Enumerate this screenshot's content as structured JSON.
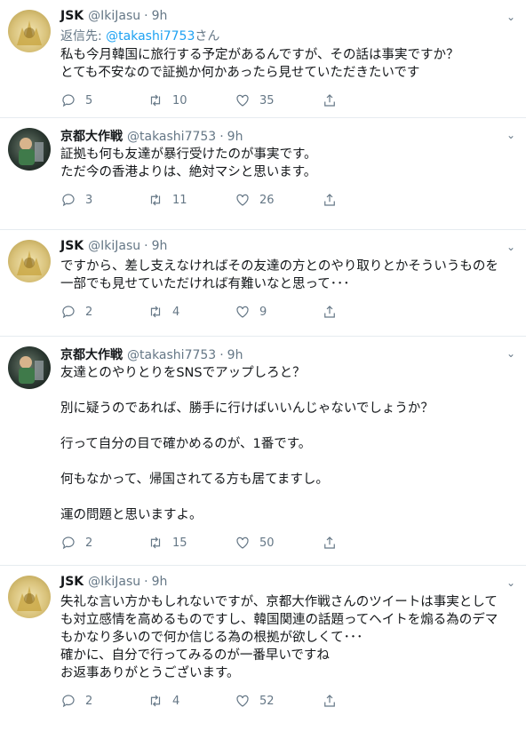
{
  "tweets": [
    {
      "user": "jsk",
      "name": "JSK",
      "handle": "@IkiJasu",
      "time": "9h",
      "reply_prefix": "返信先: ",
      "reply_mention": "@takashi7753",
      "reply_suffix": "さん",
      "text": "私も今月韓国に旅行する予定があるんですが、その話は事実ですか？\nとても不安なので証拠か何かあったら見せていただきたいです",
      "replies": "5",
      "retweets": "10",
      "likes": "35"
    },
    {
      "user": "kyoto",
      "name": "京都大作戦",
      "handle": "@takashi7753",
      "time": "9h",
      "text": "証拠も何も友達が暴行受けたのが事実です。\nただ今の香港よりは、絶対マシと思います。",
      "replies": "3",
      "retweets": "11",
      "likes": "26"
    },
    {
      "user": "jsk",
      "name": "JSK",
      "handle": "@IkiJasu",
      "time": "9h",
      "text": "ですから、差し支えなければその友達の方とのやり取りとかそういうものを\n一部でも見せていただければ有難いなと思って･･･",
      "replies": "2",
      "retweets": "4",
      "likes": "9"
    },
    {
      "user": "kyoto",
      "name": "京都大作戦",
      "handle": "@takashi7753",
      "time": "9h",
      "text": "友達とのやりとりをSNSでアップしろと？\n\n別に疑うのであれば、勝手に行けばいいんじゃないでしょうか？\n\n行って自分の目で確かめるのが、1番です。\n\n何もなかって、帰国されてる方も居てますし。\n\n運の問題と思いますよ。",
      "replies": "2",
      "retweets": "15",
      "likes": "50"
    },
    {
      "user": "jsk",
      "name": "JSK",
      "handle": "@IkiJasu",
      "time": "9h",
      "text": "失礼な言い方かもしれないですが、京都大作戦さんのツイートは事実として\nも対立感情を高めるものですし、韓国関連の話題ってヘイトを煽る為のデマ\nもかなり多いので何か信じる為の根拠が欲しくて･･･\n確かに、自分で行ってみるのが一番早いですね\nお返事ありがとうございます。",
      "replies": "2",
      "retweets": "4",
      "likes": "52"
    }
  ]
}
